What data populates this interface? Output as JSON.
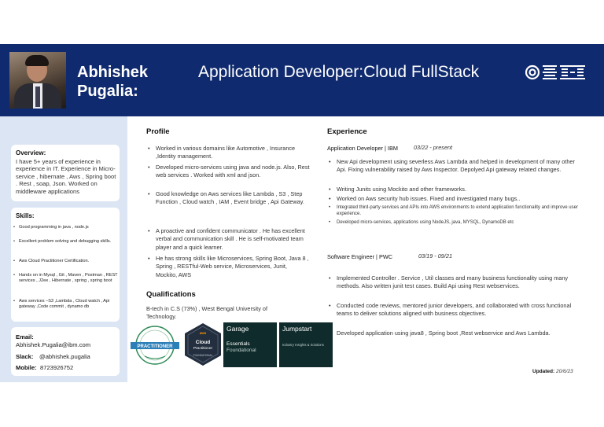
{
  "header": {
    "name_line1": "Abhishek",
    "name_line2": "Pugalia:",
    "job_title": "Application Developer:Cloud FullStack",
    "brand_color": "#0f2a6e"
  },
  "overview": {
    "title": "Overview:",
    "text": "I have 5+ years of experience in experience in IT. Experience in Micro-service , hibernate , Aws , Spring boot . Rest , soap, Json. Worked on middleware applications"
  },
  "skills": {
    "title": "Skills:",
    "items": [
      "Good programming  in java , node.js",
      "Excellent problem solving and debugging skills.",
      "Aws Cloud Practitioner Certification.",
      "Hands on in Mysql , Git , Maven , Postman , REST services , J2ee , Hibernate , spring , spring boot",
      "Aws services –S3 ,Lambda , Cloud watch , Api gateway ,Code commit , dynamo db"
    ]
  },
  "contact": {
    "email_label": "Email:",
    "email": "Abhishek.Pugalia@ibm.com",
    "slack_label": "Slack:",
    "slack": "@abhishek.pugalia",
    "mobile_label": "Mobile:",
    "mobile": "8723926752"
  },
  "profile": {
    "title": "Profile",
    "items": [
      "Worked in various domains like Automotive , Insurance ,Identity management.",
      "Developed micro-services using java and node.js. Also, Rest web services . Worked with xml and json.",
      "Good knowledge on Aws services like Lambda , S3 , Step Function , Cloud watch , IAM , Event bridge , Api Gateway.",
      "A proactive and confident communicator . He has excellent verbal and communication skill . He is self-motivated team player and a quick learner.",
      " He has strong skills like Microservices, Spring Boot, Java 8 , Spring , RESTful-Web service, Microservices, Junit, Mockito, AWS"
    ]
  },
  "qualifications": {
    "title": "Qualifications",
    "text": "B-tech in C.S (73%) , West Bengal University of Technology."
  },
  "badges": {
    "aws_practitioner": {
      "line1": "PRACTITIONER"
    },
    "aws_cloud": {
      "line1": "aws",
      "line2": "Cloud",
      "line3": "Practitioner",
      "line4": "FOUNDATIONAL"
    },
    "garage": {
      "title": "Garage",
      "line1": "Essentials",
      "line2": "Foundational"
    },
    "jumpstart": {
      "title": "Jumpstart",
      "line1": "Industry Insights & Solutions"
    }
  },
  "experience": {
    "title": "Experience",
    "jobs": [
      {
        "role": "Application Developer | IBM",
        "dates": "03/22 - present",
        "items": [
          "New Api development using severless Aws Lambda and helped in development of many other Api. Fixing vulnerability raised by Aws Inspector. Depolyed Api gateway related changes.",
          "Writing Junits using Mockito and other frameworks.",
          "Worked on Aws security hub issues. Fixed and investigated many bugs..",
          "Integrated third-party services and APIs into AWS environments to extend application functionality and improve user experience.",
          "Developed micro-services, applications using NodeJS,  java, MYSQL, DynamoDB etc"
        ]
      },
      {
        "role": "Software Engineer | PWC",
        "dates": "03/19 - 09/21",
        "items": [
          "Implemented Controller . Service , Util classes and many business functionality using many methods. Also written junit test cases. Build Api using Rest webservices.",
          "Conducted code reviews, mentored junior developers, and collaborated with cross functional teams to deliver solutions aligned with business objectives."
        ],
        "extra": "Developed application using java8 , Spring boot ,Rest webservice and Aws Lambda."
      }
    ]
  },
  "updated": {
    "label": "Updated:",
    "date": "20/6/23"
  }
}
